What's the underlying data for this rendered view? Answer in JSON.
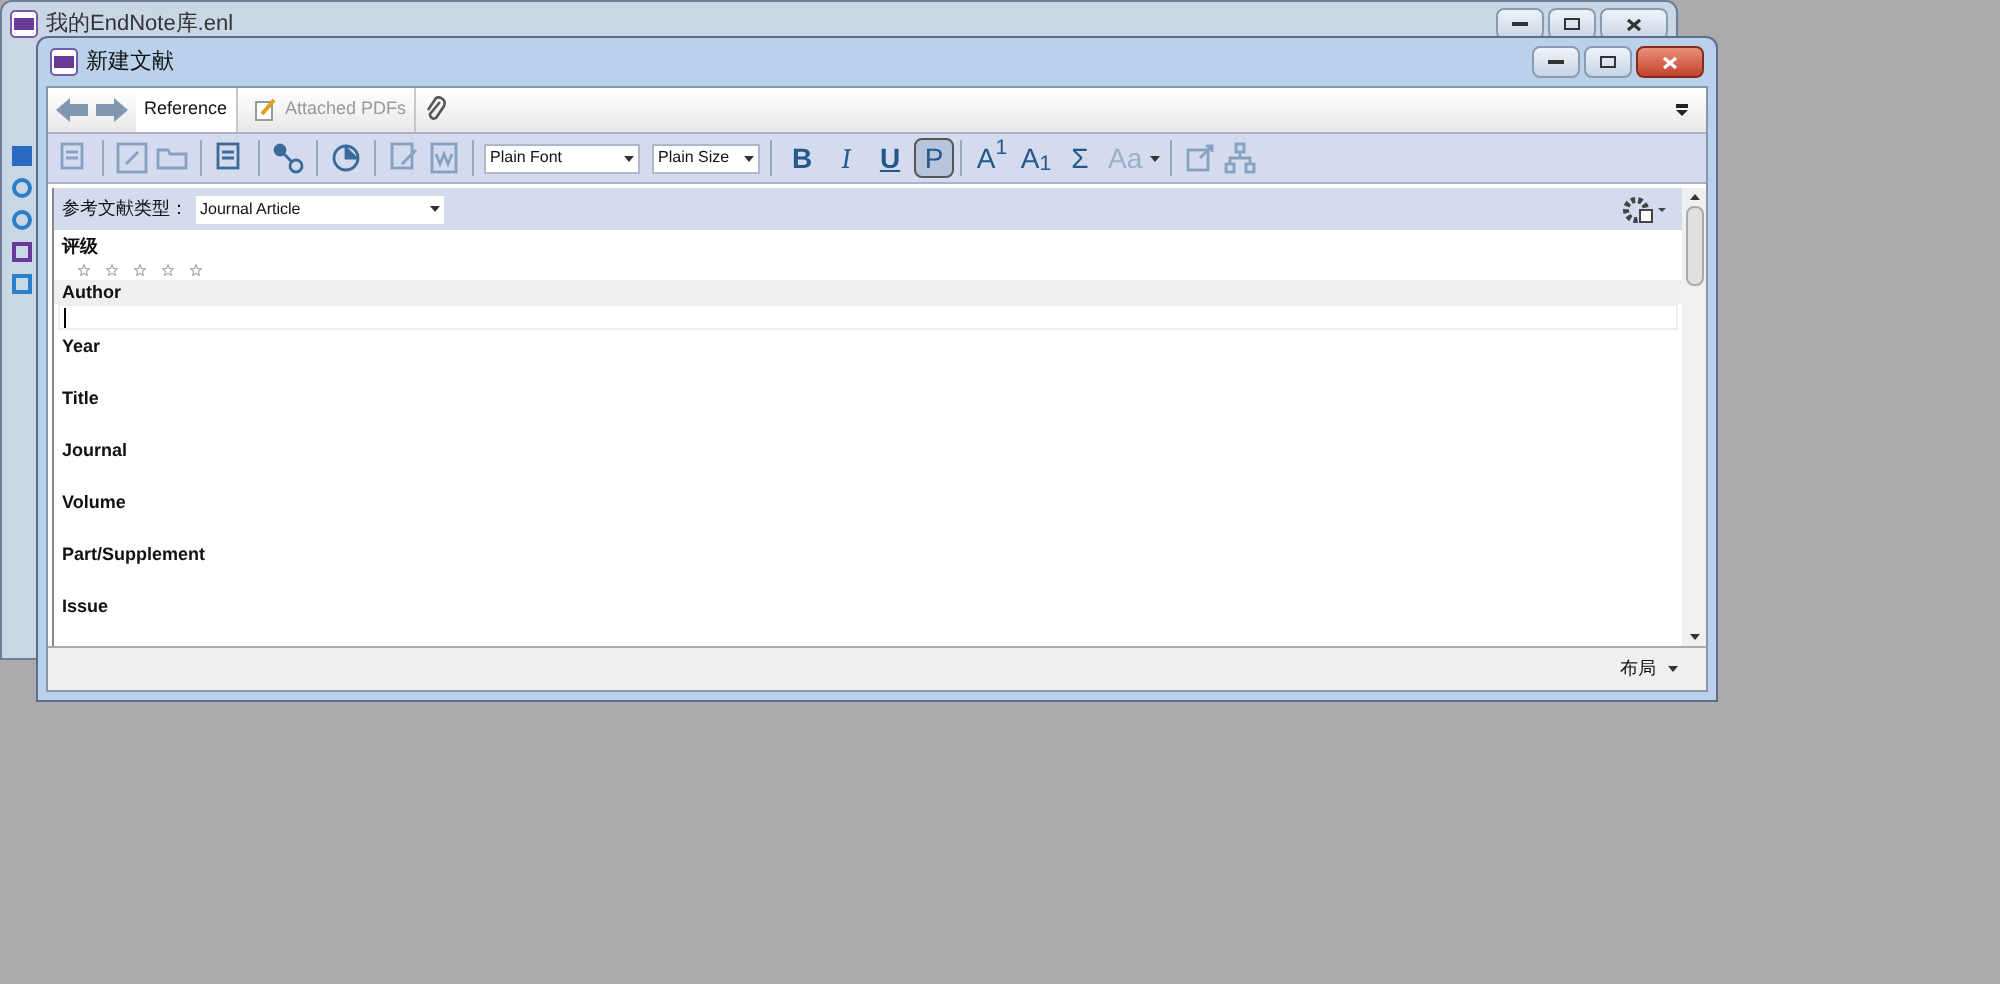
{
  "back_window": {
    "title": "我的EndNote库.enl"
  },
  "window": {
    "title": "新建文献"
  },
  "tabs": [
    {
      "label": "Reference",
      "selected": true
    },
    {
      "label": "Attached PDFs",
      "selected": false
    }
  ],
  "font_select": {
    "value": "Plain Font"
  },
  "size_select": {
    "value": "Plain Size"
  },
  "format_buttons": [
    {
      "label": "B",
      "kind": "bold",
      "pressed": false,
      "disabled": false
    },
    {
      "label": "I",
      "kind": "italic",
      "pressed": false,
      "disabled": false
    },
    {
      "label": "U",
      "kind": "underline",
      "pressed": false,
      "disabled": false
    },
    {
      "label": "P",
      "kind": "plain",
      "pressed": true,
      "disabled": false
    },
    {
      "label": "A$^{1}$",
      "kind": "plain",
      "pressed": false,
      "disabled": false
    },
    {
      "label": "A$_{1}$",
      "kind": "plain",
      "pressed": false,
      "disabled": false
    },
    {
      "label": "Σ",
      "kind": "plain",
      "pressed": false,
      "disabled": false
    },
    {
      "label": "Aa",
      "kind": "plain",
      "pressed": false,
      "disabled": true
    }
  ],
  "reference_type": {
    "label": "参考文献类型：",
    "value": "Journal Article"
  },
  "rating": {
    "label": "评级",
    "stars": 0
  },
  "fields": [
    {
      "label": "Author",
      "active": true
    },
    {
      "label": "Year",
      "active": false
    },
    {
      "label": "Title",
      "active": false
    },
    {
      "label": "Journal",
      "active": false
    },
    {
      "label": "Volume",
      "active": false
    },
    {
      "label": "Part/Supplement",
      "active": false
    },
    {
      "label": "Issue",
      "active": false
    }
  ],
  "status_bar": {
    "layout_button": "布局"
  }
}
